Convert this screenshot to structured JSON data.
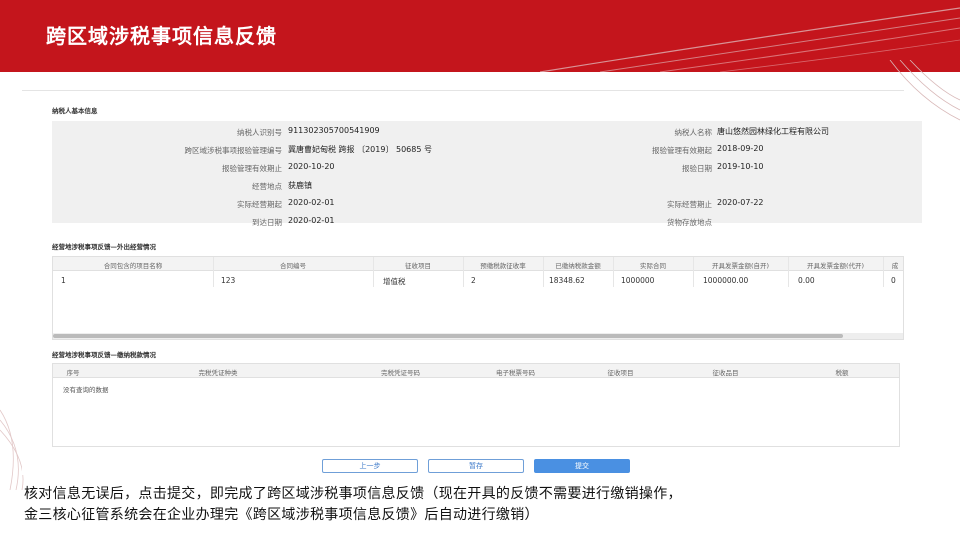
{
  "slide": {
    "title": "跨区域涉税事项信息反馈",
    "caption_line1": "核对信息无误后，点击提交，即完成了跨区域涉税事项信息反馈（现在开具的反馈不需要进行缴销操作，",
    "caption_line2": "金三核心征管系统会在企业办理完《跨区域涉税事项信息反馈》后自动进行缴销）"
  },
  "basic_info": {
    "section_title": "纳税人基本信息",
    "rows": [
      {
        "l_label": "纳税人识别号",
        "l_value": "911302305700541909",
        "r_label": "纳税人名称",
        "r_value": "唐山悠然园林绿化工程有限公司"
      },
      {
        "l_label": "跨区域涉税事项报验管理编号",
        "l_value": "冀唐曹妃甸税 跨报 〔2019〕 50685 号",
        "r_label": "报验管理有效期起",
        "r_value": "2018-09-20"
      },
      {
        "l_label": "报验管理有效期止",
        "l_value": "2020-10-20",
        "r_label": "报验日期",
        "r_value": "2019-10-10"
      },
      {
        "l_label": "经营地点",
        "l_value": "获鹿镇",
        "r_label": "",
        "r_value": ""
      },
      {
        "l_label": "实际经营期起",
        "l_value": "2020-02-01",
        "r_label": "实际经营期止",
        "r_value": "2020-07-22"
      },
      {
        "l_label": "到达日期",
        "l_value": "2020-02-01",
        "r_label": "货物存放地点",
        "r_value": ""
      }
    ]
  },
  "grid1": {
    "section_title": "经营地涉税事项反馈—外出经营情况",
    "headers": [
      "合同包含的项目名称",
      "合同编号",
      "征收项目",
      "预缴税款征收率",
      "已缴纳税款金额",
      "实际合同",
      "开具发票金额(自开)",
      "开具发票金额(代开)",
      "成"
    ],
    "row": [
      "1",
      "123",
      "增值税",
      "2",
      "18348.62",
      "1000000",
      "1000000.00",
      "0.00",
      "0"
    ]
  },
  "grid2": {
    "section_title": "经营地涉税事项反馈—缴纳税款情况",
    "headers": [
      "序号",
      "完税凭证种类",
      "完税凭证号码",
      "电子税票号码",
      "征收项目",
      "征收品目",
      "税额"
    ],
    "empty_text": "没有查询的数据"
  },
  "buttons": {
    "prev": "上一步",
    "save": "暂存",
    "submit": "提交"
  },
  "colors": {
    "banner": "#c4151c",
    "primary": "#4a90e2"
  }
}
